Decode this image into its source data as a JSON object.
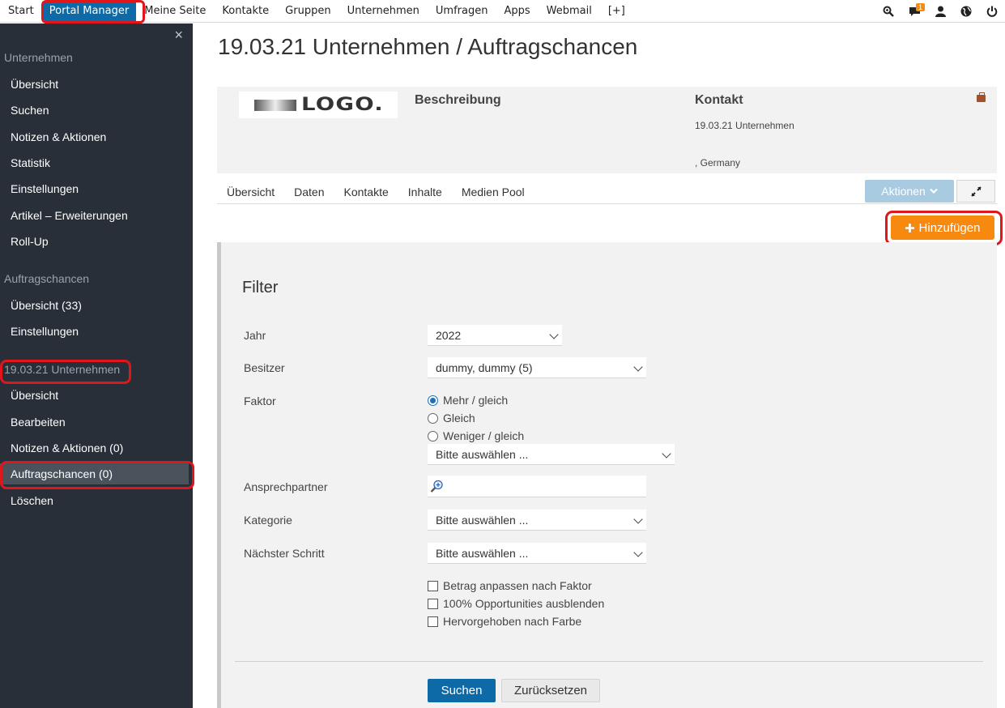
{
  "topnav": {
    "items": [
      "Start",
      "Portal Manager",
      "Meine Seite",
      "Kontakte",
      "Gruppen",
      "Unternehmen",
      "Umfragen",
      "Apps",
      "Webmail",
      "[+]"
    ],
    "active": "Portal Manager",
    "icons": [
      "search-icon",
      "chat-icon",
      "user-icon",
      "globe-icon",
      "power-icon"
    ],
    "chat_badge": "1"
  },
  "sidebar": {
    "close_glyph": "×",
    "section_unternehmen": "Unternehmen",
    "unternehmen_items": [
      "Übersicht",
      "Suchen",
      "Notizen & Aktionen",
      "Statistik",
      "Einstellungen",
      "Artikel – Erweiterungen",
      "Roll-Up"
    ],
    "section_auftragschancen": "Auftragschancen",
    "auftragschancen_items": [
      "Übersicht (33)",
      "Einstellungen"
    ],
    "section_company": "19.03.21 Unternehmen",
    "company_items": [
      "Übersicht",
      "Bearbeiten",
      "Notizen & Aktionen (0)",
      "Auftragschancen (0)",
      "Löschen"
    ],
    "active_item": "Auftragschancen (0)"
  },
  "main": {
    "title": "19.03.21 Unternehmen / Auftragschancen",
    "logo_text": "LOGO.",
    "description_label": "Beschreibung",
    "contact_label": "Kontakt",
    "contact_company": "19.03.21 Unternehmen",
    "contact_country": ", Germany",
    "tabs": [
      "Übersicht",
      "Daten",
      "Kontakte",
      "Inhalte",
      "Medien Pool"
    ],
    "actions_label": "Aktionen",
    "add_label": "Hinzufügen"
  },
  "filter": {
    "title": "Filter",
    "jahr_label": "Jahr",
    "jahr_value": "2022",
    "besitzer_label": "Besitzer",
    "besitzer_value": "dummy, dummy (5)",
    "faktor_label": "Faktor",
    "faktor_options": [
      "Mehr / gleich",
      "Gleich",
      "Weniger / gleich"
    ],
    "faktor_selected": "Mehr / gleich",
    "faktor_select_value": "Bitte auswählen ...",
    "ansprechpartner_label": "Ansprechpartner",
    "kategorie_label": "Kategorie",
    "kategorie_value": "Bitte auswählen ...",
    "schritt_label": "Nächster Schritt",
    "schritt_value": "Bitte auswählen ...",
    "checkboxes": [
      "Betrag anpassen nach Faktor",
      "100% Opportunities ausblenden",
      "Hervorgehoben nach Farbe"
    ],
    "search_button": "Suchen",
    "reset_button": "Zurücksetzen"
  },
  "colors": {
    "primary_blue": "#0d6aa6",
    "orange": "#f7890e",
    "sidebar_bg": "#282f38",
    "highlight_red": "#e0161b"
  }
}
